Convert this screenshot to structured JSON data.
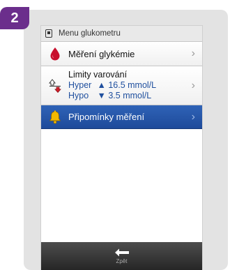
{
  "step": {
    "number": "2"
  },
  "screen": {
    "title": "Menu glukometru",
    "items": [
      {
        "label": "Měření glykémie",
        "icon": "blood-drop-icon"
      },
      {
        "label": "Limity varování",
        "icon": "warning-limits-icon",
        "hyper": {
          "name": "Hyper",
          "arrow": "▲",
          "value": "16.5 mmol/L"
        },
        "hypo": {
          "name": "Hypo",
          "arrow": "▼",
          "value": "3.5 mmol/L"
        }
      },
      {
        "label": "Připomínky měření",
        "icon": "bell-icon",
        "selected": true
      }
    ],
    "chevron": "›",
    "footer": {
      "back_label": "Zpět",
      "icon": "back-arrow-icon"
    }
  },
  "colors": {
    "badge": "#6b2e8c",
    "selected_row": "#2a5cb0",
    "limit_text": "#1f4f9e",
    "drop": "#c8102e",
    "bell": "#f2b900"
  }
}
